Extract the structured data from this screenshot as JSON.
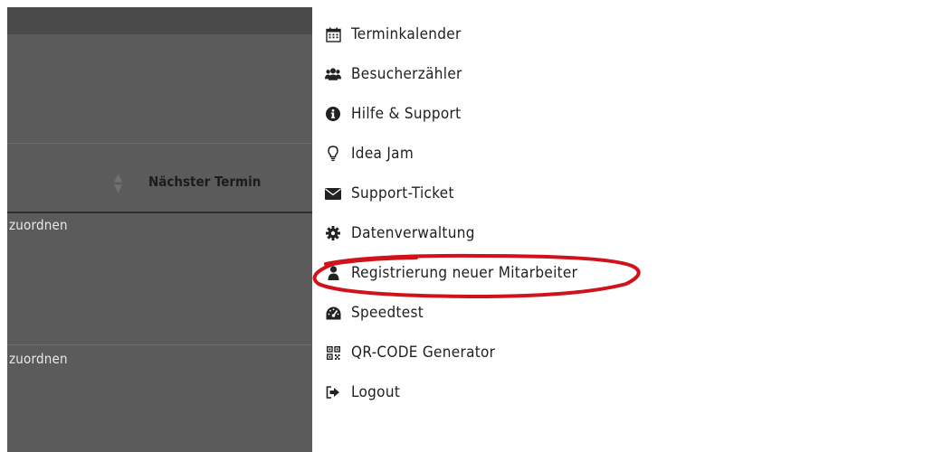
{
  "background": {
    "column_header": "Nächster Termin",
    "rows": [
      {
        "action_text": "zuordnen"
      },
      {
        "action_text": "zuordnen"
      }
    ]
  },
  "menu": {
    "items": [
      {
        "label": "Terminkalender",
        "icon": "calendar-icon"
      },
      {
        "label": "Besucherzähler",
        "icon": "users-icon"
      },
      {
        "label": "Hilfe & Support",
        "icon": "info-icon"
      },
      {
        "label": "Idea Jam",
        "icon": "lightbulb-icon"
      },
      {
        "label": "Support-Ticket",
        "icon": "envelope-icon"
      },
      {
        "label": "Datenverwaltung",
        "icon": "gear-icon"
      },
      {
        "label": "Registrierung neuer Mitarbeiter",
        "icon": "user-icon"
      },
      {
        "label": "Speedtest",
        "icon": "speedometer-icon"
      },
      {
        "label": "QR-CODE Generator",
        "icon": "qrcode-icon"
      },
      {
        "label": "Logout",
        "icon": "logout-icon"
      }
    ]
  },
  "annotation": {
    "color": "#d0131b"
  }
}
